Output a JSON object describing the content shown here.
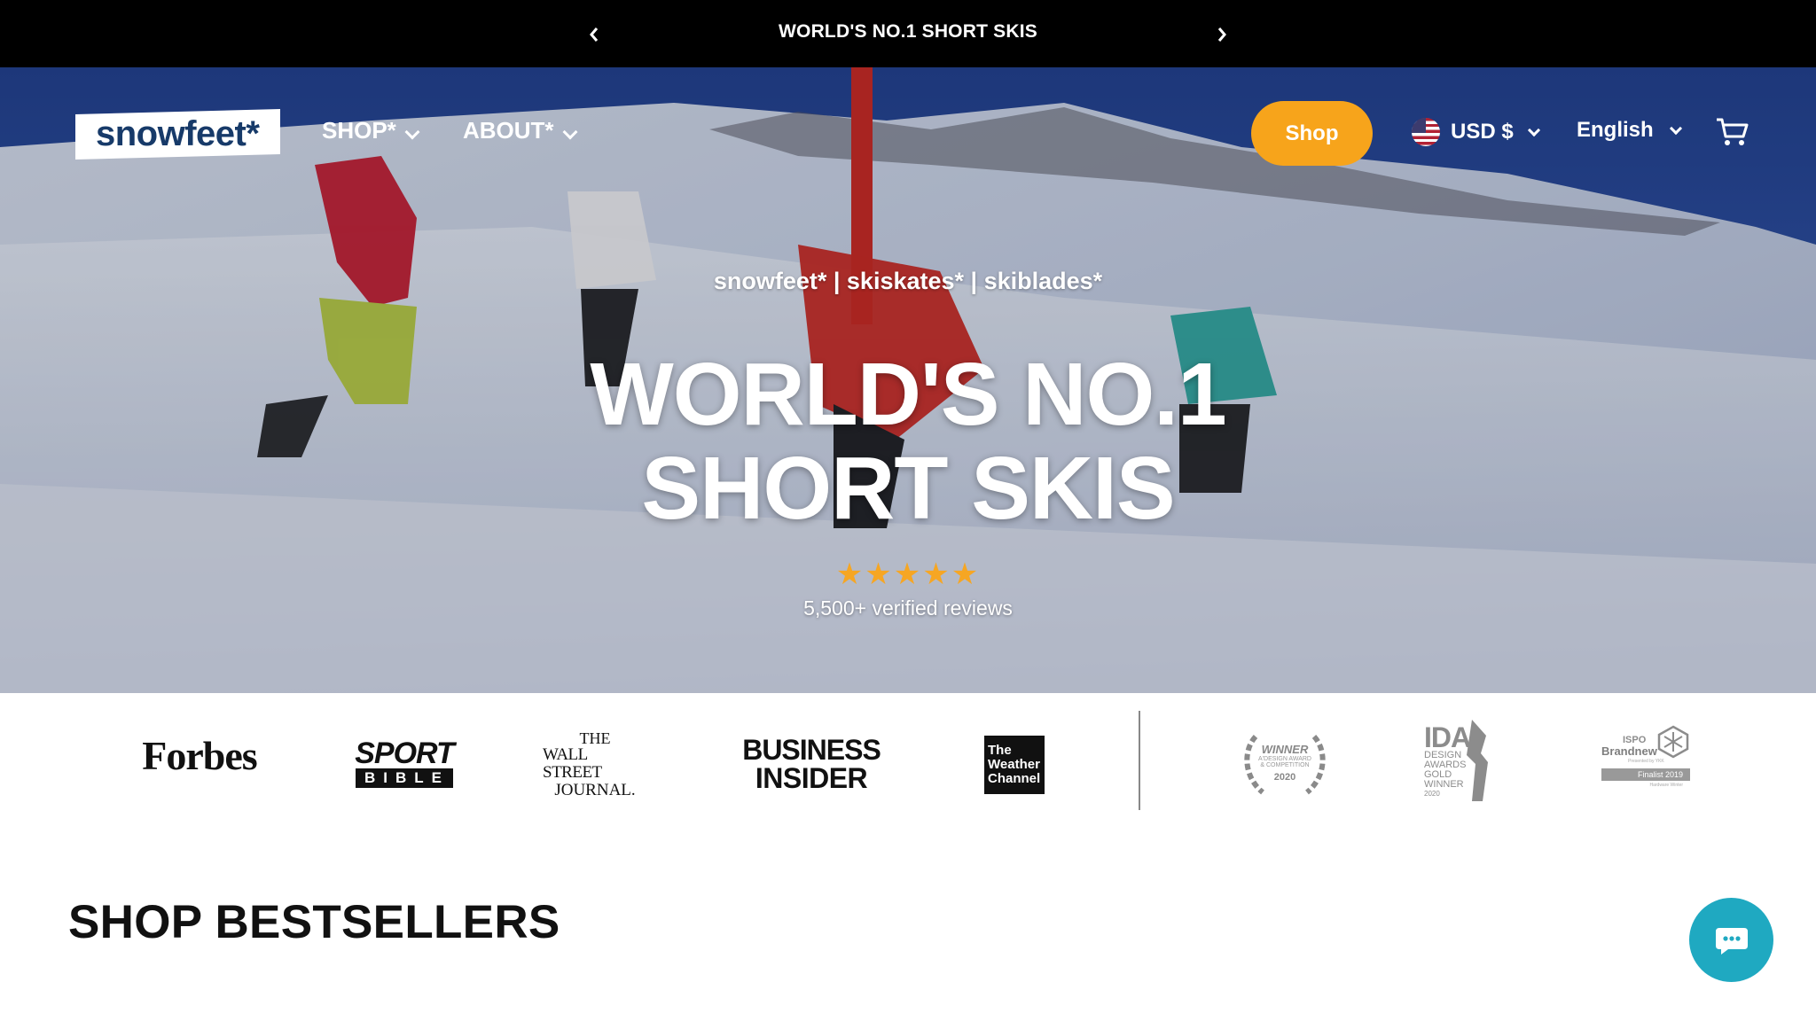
{
  "announcement": {
    "text": "WORLD'S NO.1 SHORT SKIS",
    "prev_icon": "chevron-left-icon",
    "next_icon": "chevron-right-icon"
  },
  "header": {
    "logo_text": "snowfeet*",
    "nav": [
      {
        "label": "SHOP*"
      },
      {
        "label": "ABOUT*"
      }
    ],
    "shop_button": "Shop",
    "currency": "USD $",
    "language": "English",
    "cart_icon": "cart-icon"
  },
  "hero": {
    "tagline": "snowfeet* | skiskates* | skiblades*",
    "headline_line1": "WORLD'S NO.1",
    "headline_line2": "SHORT SKIS",
    "stars": "★★★★★",
    "rating": 5,
    "reviews": "5,500+ verified reviews"
  },
  "press": {
    "forbes": "Forbes",
    "sport_top": "SPORT",
    "sport_bottom": "BIBLE",
    "wsj_line1": "THE",
    "wsj_line2": "WALL STREET",
    "wsj_line3": "JOURNAL.",
    "bi_line1": "BUSINESS",
    "bi_line2": "INSIDER",
    "weather_line1": "The",
    "weather_line2": "Weather",
    "weather_line3": "Channel",
    "award_winner": "WINNER",
    "award_sub1": "A'DESIGN AWARD",
    "award_sub2": "& COMPETITION",
    "award_year": "2020",
    "ida_big": "IDA",
    "ida_line1": "DESIGN",
    "ida_line2": "AWARDS",
    "ida_line3": "GOLD",
    "ida_line4": "WINNER",
    "ida_year": "2020",
    "ispo_line1": "ISPO",
    "ispo_line2": "Brandnew",
    "ispo_presented": "Presented by YKK",
    "ispo_finalist": "Finalist 2019",
    "ispo_category": "Hardware Winter"
  },
  "section": {
    "title": "SHOP BESTSELLERS"
  },
  "chat_icon": "chat-bubble-icon",
  "colors": {
    "accent": "#f7a41b",
    "chat": "#1fa9c1",
    "star": "#f6a623",
    "logo_text": "#173a69"
  }
}
